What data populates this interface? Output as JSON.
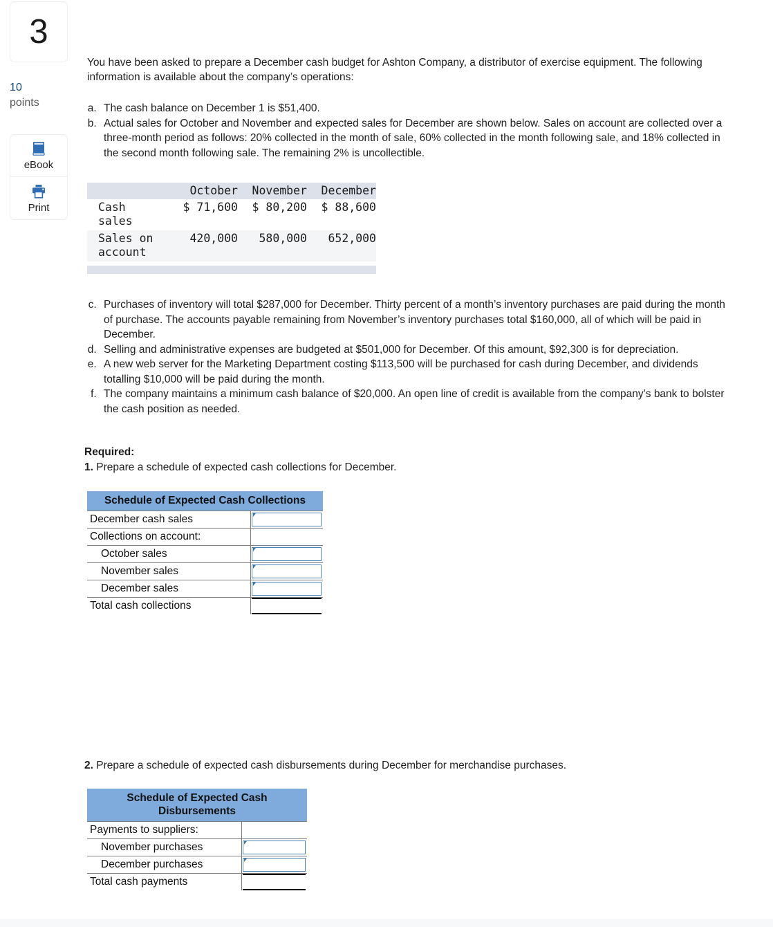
{
  "question": {
    "number": "3",
    "points_value": "10",
    "points_label": "points"
  },
  "rail": {
    "ebook_label": "eBook",
    "ebook_icon": "book-icon",
    "print_label": "Print",
    "print_icon": "printer-icon"
  },
  "intro": "You have been asked to prepare a December cash budget for Ashton Company, a distributor of exercise equipment. The following information is available about the company’s operations:",
  "facts_first": [
    "The cash balance on December 1 is $51,400.",
    "Actual sales for October and November and expected sales for December are shown below. Sales on account are collected over a three-month period as follows: 20% collected in the month of sale, 60% collected in the month following sale, and 18% collected in the second month following sale. The remaining 2% is uncollectible."
  ],
  "facts_second": [
    "Purchases of inventory will total $287,000 for December. Thirty percent of a month’s inventory purchases are paid during the month of purchase. The accounts payable remaining from November’s inventory purchases total $160,000, all of which will be paid in December.",
    "Selling and administrative expenses are budgeted at $501,000 for December. Of this amount, $92,300 is for depreciation.",
    "A new web server for the Marketing Department costing $113,500 will be purchased for cash during December, and dividends totalling $10,000 will be paid during the month.",
    "The company maintains a minimum cash balance of $20,000. An open line of credit is available from the company’s bank to bolster the cash position as needed."
  ],
  "sales_table": {
    "columns": [
      "October",
      "November",
      "December"
    ],
    "rows": [
      {
        "label": "Cash\nsales",
        "values": [
          "$ 71,600",
          "$ 80,200",
          "$ 88,600"
        ]
      },
      {
        "label": "Sales on\naccount",
        "values": [
          "420,000",
          "580,000",
          "652,000"
        ]
      }
    ]
  },
  "required": {
    "heading": "Required:",
    "item1_num": "1.",
    "item1_text": " Prepare a schedule of expected cash collections for December.",
    "item2_num": "2.",
    "item2_text": " Prepare a schedule of expected cash disbursements during December for merchandise purchases."
  },
  "schedule_collections": {
    "title": "Schedule of Expected Cash Collections",
    "rows": [
      {
        "label": "December cash sales",
        "input": true,
        "indent": false,
        "total": false,
        "value": ""
      },
      {
        "label": "Collections on account:",
        "input": false,
        "indent": false,
        "total": false,
        "value": ""
      },
      {
        "label": "October sales",
        "input": true,
        "indent": true,
        "total": false,
        "value": ""
      },
      {
        "label": "November sales",
        "input": true,
        "indent": true,
        "total": false,
        "value": ""
      },
      {
        "label": "December sales",
        "input": true,
        "indent": true,
        "total": false,
        "value": ""
      },
      {
        "label": "Total cash collections",
        "input": false,
        "indent": false,
        "total": true,
        "value": ""
      }
    ]
  },
  "schedule_disbursements": {
    "title": "Schedule of Expected Cash Disbursements",
    "rows": [
      {
        "label": "Payments to suppliers:",
        "input": false,
        "indent": false,
        "total": false,
        "value": ""
      },
      {
        "label": "November purchases",
        "input": true,
        "indent": true,
        "total": false,
        "value": ""
      },
      {
        "label": "December purchases",
        "input": true,
        "indent": true,
        "total": false,
        "value": ""
      },
      {
        "label": "Total cash payments",
        "input": false,
        "indent": false,
        "total": true,
        "value": ""
      }
    ]
  },
  "colors": {
    "schedule_header_blue": "#7eabdc",
    "input_border_blue": "#4a7fb8",
    "points_blue": "#16497a",
    "mono_header_bg": "#dde1e9",
    "icon_blue": "#2f6db5"
  }
}
